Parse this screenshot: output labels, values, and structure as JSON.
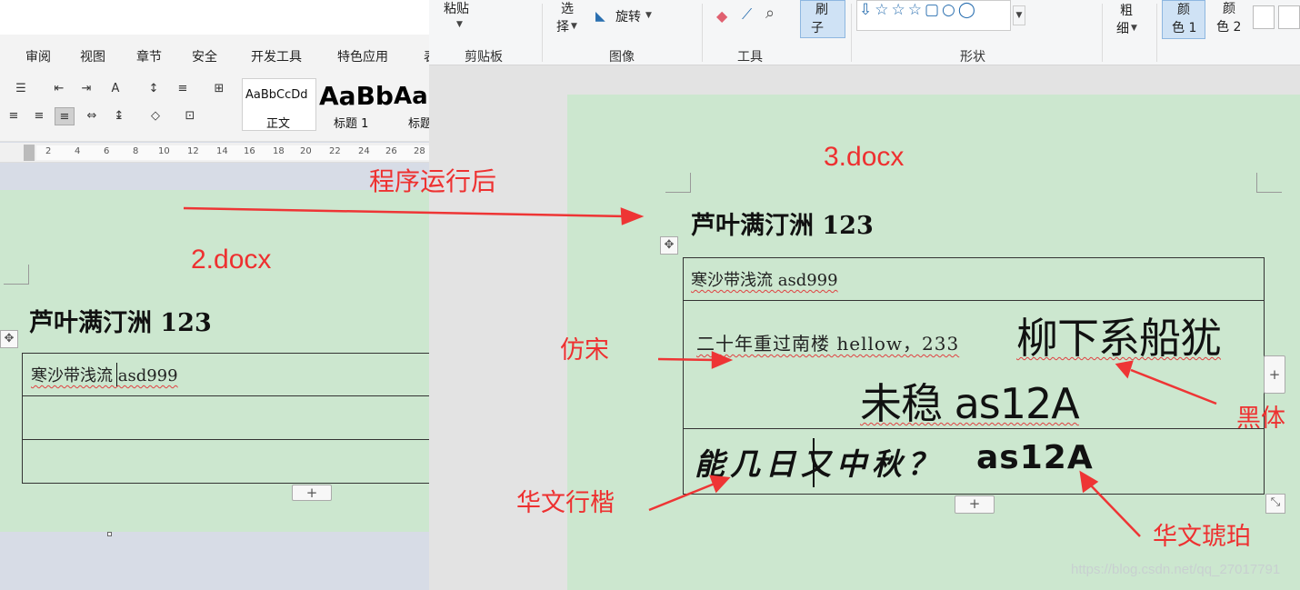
{
  "left_window": {
    "menu": [
      "审阅",
      "视图",
      "章节",
      "安全",
      "开发工具",
      "特色应用",
      "表"
    ],
    "styles": [
      {
        "preview": "AaBbCcDd",
        "name": "正文"
      },
      {
        "preview": "AaBb",
        "name": "标题 1"
      },
      {
        "preview": "AaI",
        "name": "标题"
      }
    ],
    "ruler_ticks": [
      "2",
      "4",
      "6",
      "8",
      "10",
      "12",
      "14",
      "16",
      "18",
      "20",
      "22",
      "24",
      "26",
      "28"
    ],
    "doc_label": "2.docx",
    "title": "芦叶满汀洲 123",
    "row1": "寒沙带浅流 asd999",
    "add_row": "+"
  },
  "right_window": {
    "ribbon": {
      "paste": "粘贴",
      "select_line1": "选",
      "select_line2": "择",
      "rotate": "旋转",
      "brush_line1": "刷",
      "brush_line2": "子",
      "thickness_line1": "粗",
      "thickness_line2": "细",
      "color1_line1": "颜",
      "color1_line2": "色 1",
      "color2_line1": "颜",
      "color2_line2": "色 2",
      "groups": [
        "剪贴板",
        "图像",
        "工具",
        "形状"
      ]
    },
    "doc_label": "3.docx",
    "title": "芦叶满汀洲 123",
    "row1": "寒沙带浅流 asd999",
    "row2_fangsong": "二十年重过南楼 hellow，233",
    "row2_heiti_a": "柳下系船犹",
    "row2_heiti_b": "未稳 as12A",
    "row3_xingkai": "能几日又中秋？",
    "row3_hupo": "as12A",
    "add_row": "+",
    "side_plus": "+"
  },
  "annotations": {
    "after_run": "程序运行后",
    "fangsong": "仿宋",
    "heiti": "黑体",
    "huawen_xingkai": "华文行楷",
    "huawen_hupo": "华文琥珀"
  },
  "watermark": "https://blog.csdn.net/qq_27017791",
  "colors": {
    "annotation": "#ee3030",
    "page_bg": "#cce7cf",
    "wavy": "#e04040"
  }
}
